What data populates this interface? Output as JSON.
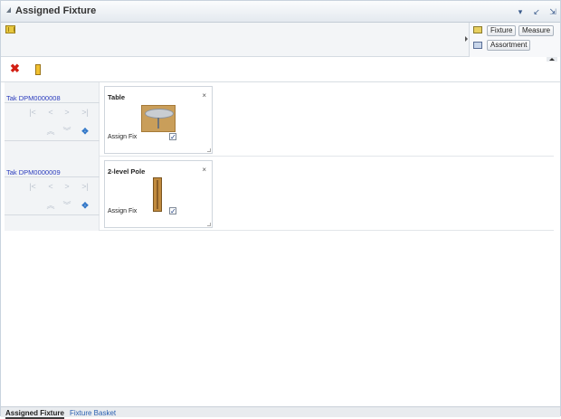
{
  "window": {
    "title": "Assigned Fixture"
  },
  "titlebar_icons": [
    "chevron-down-icon",
    "shrink-icon",
    "detach-icon"
  ],
  "right_panel": {
    "fixture_label": "Fixture",
    "measure_label": "Measure",
    "assortment_label": "Assortment"
  },
  "toolbar": {
    "delete_icon": "delete-icon",
    "assign_icon": "fixture-icon"
  },
  "rows": [
    {
      "link": "Tak DPM0000008",
      "card_title": "Table",
      "assign_label": "Assign Fix",
      "assigned": true,
      "image": "table-fixture-image"
    },
    {
      "link": "Tak DPM0000009",
      "card_title": "2-level Pole",
      "assign_label": "Assign Fix",
      "assigned": true,
      "image": "pole-fixture-image"
    }
  ],
  "nav_glyphs": {
    "first": "|<",
    "prev": "<",
    "next": ">",
    "last": ">|",
    "up": "︽",
    "down": "︾",
    "expand": "✥",
    "check": "✓",
    "close": "×",
    "delete": "✖"
  },
  "tabs": {
    "active": "Assigned Fixture",
    "inactive": "Fixture Basket"
  }
}
